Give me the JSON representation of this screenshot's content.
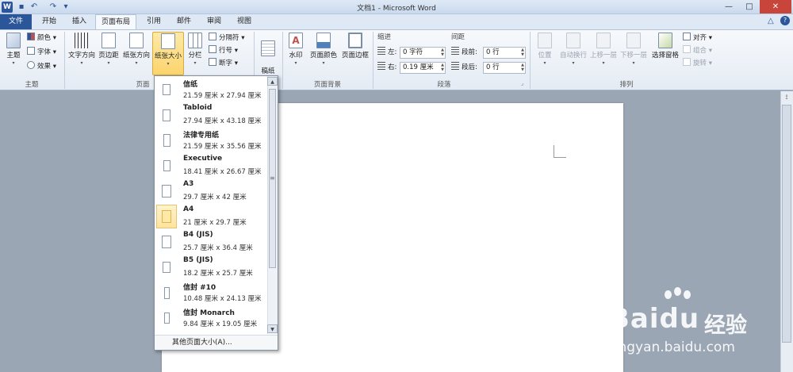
{
  "window": {
    "title": "文档1 - Microsoft Word",
    "min": "—",
    "max": "□",
    "close": "✕"
  },
  "quick_access": {
    "logo": "W",
    "save": "💾",
    "undo": "↶",
    "redo": "↷",
    "custom": "▾"
  },
  "tabs": [
    "文件",
    "开始",
    "插入",
    "页面布局",
    "引用",
    "邮件",
    "审阅",
    "视图"
  ],
  "ribbon": {
    "theme_group": {
      "label": "主题",
      "theme_button": "主题",
      "colors": "颜色 ▾",
      "fonts": "字体 ▾",
      "effects": "效果 ▾"
    },
    "page_setup_group": {
      "label": "页面",
      "text_direction": "文字方向",
      "margins": "页边距",
      "orientation": "纸张方向",
      "size": "纸张大小",
      "columns": "分栏",
      "breaks": "分隔符 ▾",
      "line_numbers": "行号 ▾",
      "hyphenation": "断字 ▾"
    },
    "manuscript_group": {
      "button": "稿纸\n设置"
    },
    "page_background_group": {
      "label": "页面背景",
      "watermark": "水印",
      "page_color": "页面颜色",
      "page_borders": "页面边框"
    },
    "paragraph_group": {
      "label": "段落",
      "indent_title": "缩进",
      "spacing_title": "间距",
      "left_label": "左:",
      "left_value": "0 字符",
      "right_label": "右:",
      "right_value": "0.19 厘米",
      "before_label": "段前:",
      "before_value": "0 行",
      "after_label": "段后:",
      "after_value": "0 行"
    },
    "arrange_group": {
      "label": "排列",
      "position": "位置",
      "wrap_text": "自动换行",
      "bring_forward": "上移一层",
      "send_backward": "下移一层",
      "selection_pane": "选择窗格",
      "align": "对齐 ▾",
      "group": "组合 ▾",
      "rotate": "旋转 ▾"
    }
  },
  "paper_sizes": [
    {
      "name": "信纸",
      "size": "21.59 厘米 x 27.94 厘米",
      "selected": false
    },
    {
      "name": "Tabloid",
      "size": "27.94 厘米 x 43.18 厘米",
      "selected": false
    },
    {
      "name": "法律专用纸",
      "size": "21.59 厘米 x 35.56 厘米",
      "selected": false
    },
    {
      "name": "Executive",
      "size": "18.41 厘米 x 26.67 厘米",
      "selected": false
    },
    {
      "name": "A3",
      "size": "29.7 厘米 x 42 厘米",
      "selected": false
    },
    {
      "name": "A4",
      "size": "21 厘米 x 29.7 厘米",
      "selected": true
    },
    {
      "name": "B4 (JIS)",
      "size": "25.7 厘米 x 36.4 厘米",
      "selected": false
    },
    {
      "name": "B5 (JIS)",
      "size": "18.2 厘米 x 25.7 厘米",
      "selected": false
    },
    {
      "name": "信封 #10",
      "size": "10.48 厘米 x 24.13 厘米",
      "selected": false
    },
    {
      "name": "信封 Monarch",
      "size": "9.84 厘米 x 19.05 厘米",
      "selected": false
    }
  ],
  "more_sizes": "其他页面大小(A)...",
  "watermark": {
    "logo_text": "Bai",
    "logo_du": "du",
    "logo_cn": "经验",
    "url": "jingyan.baidu.com"
  },
  "colors": {
    "accent": "#2b579a",
    "selected_bg": "#fde9a8",
    "selected_border": "#d9aa3d"
  }
}
